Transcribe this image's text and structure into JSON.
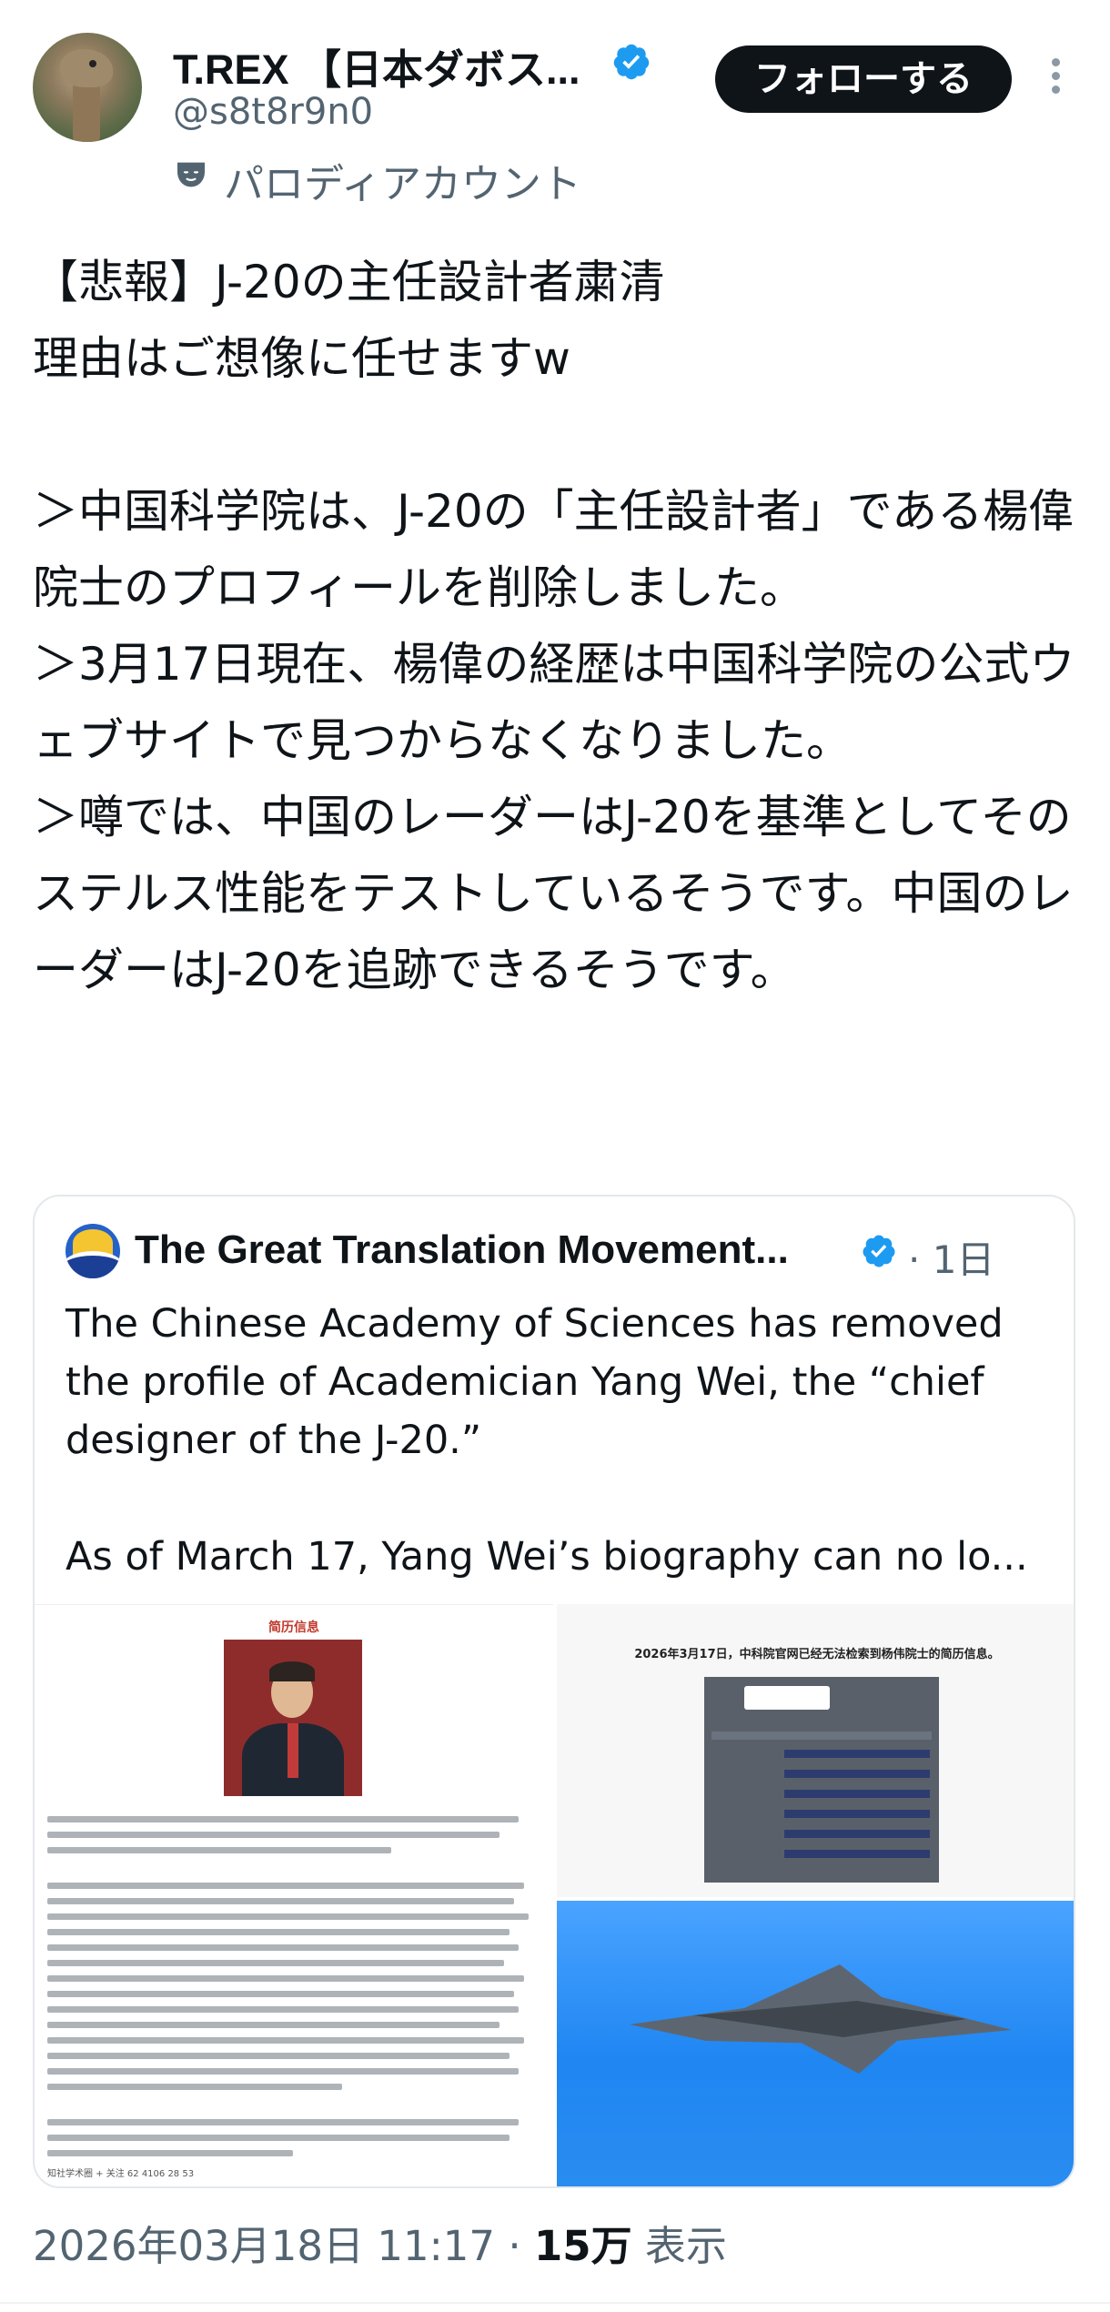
{
  "author": {
    "name": "T.REX 【日本ダボス...",
    "handle": "@s8t8r9n0",
    "account_label": "パロディアカウント"
  },
  "actions": {
    "follow_label": "フォローする"
  },
  "tweet": {
    "text": "【悲報】J-20の主任設計者粛清\n理由はご想像に任せますw\n\n＞中国科学院は、J-20の「主任設計者」である楊偉院士のプロフィールを削除しました。\n＞3月17日現在、楊偉の経歴は中国科学院の公式ウェブサイトで見つからなくなりました。\n＞噂では、中国のレーダーはJ-20を基準としてそのステルス性能をテストしているそうです。中国のレーダーはJ-20を追跡できるそうです。"
  },
  "quote": {
    "name": "The Great Translation Movement...",
    "time": "· 1日",
    "text": "The Chinese Academy of Sciences has removed the profile of Academician Yang Wei, the “chief designer of the J-20.”\n\nAs of March 17, Yang Wei’s biography can no lo..."
  },
  "media": {
    "doc_title": "简历信息",
    "doc_footer": "知社学术圈  + 关注    62   4106   28   53",
    "screenshot_title": "2026年3月17日，中科院官网已经无法检索到杨伟院士的简历信息。"
  },
  "meta": {
    "timestamp": "2026年03月18日 11:17 · ",
    "views": "15万",
    "views_suffix": " 表示"
  },
  "colors": {
    "verified": "#1d9bf0",
    "text": "#0f1419",
    "secondary": "#536471"
  },
  "icons": [
    "verified-badge-icon",
    "parody-mask-icon",
    "more-options-icon"
  ]
}
